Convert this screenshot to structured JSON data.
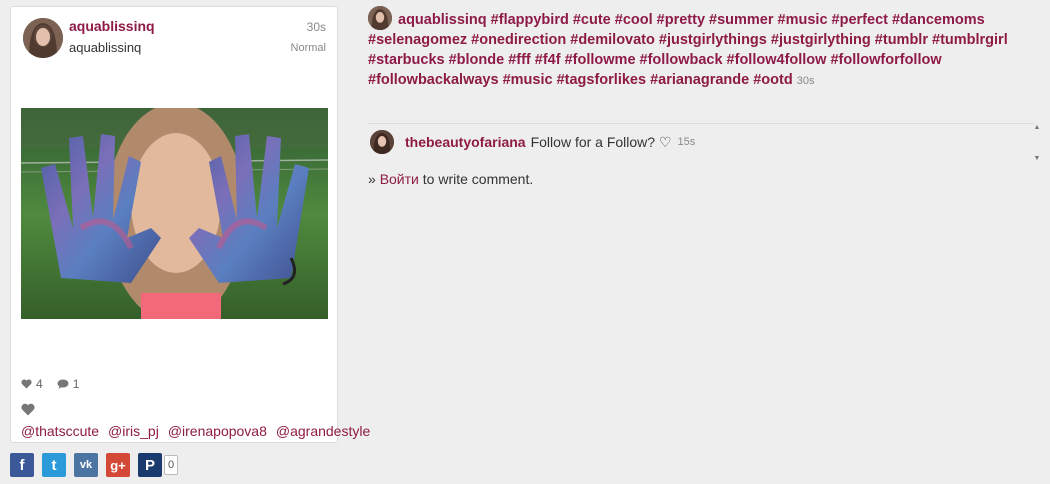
{
  "post": {
    "username": "aquablissinq",
    "fullname": "aquablissinq",
    "time": "30s",
    "filter": "Normal",
    "likes_count": "4",
    "comments_count": "1",
    "likers": [
      "@thatsccute",
      "@iris_pj",
      "@irenapopova8",
      "@agrandestyle"
    ],
    "caption_user": "aquablissinq",
    "caption_text": "#flappybird #cute #cool #pretty #summer #music #perfect #dancemoms #selenagomez #onedirection #demilovato #justgirlythings #justgirlything #tumblr #tumblrgirl #starbucks #blonde #fff #f4f #followme #followback #follow4follow #followforfollow #followbackalways #music #tagsforlikes #arianagrande #ootd",
    "caption_time": "30s"
  },
  "comments": [
    {
      "user": "thebeautyofariana",
      "text": "Follow for a Follow? ♡",
      "time": "15s"
    }
  ],
  "login": {
    "prefix": "»",
    "link": "Войти",
    "suffix": "to write comment."
  },
  "share": {
    "buttons": [
      {
        "name": "facebook",
        "glyph": "f",
        "color": "#3b5998"
      },
      {
        "name": "twitter",
        "glyph": "t",
        "color": "#2b9ad8"
      },
      {
        "name": "vk",
        "glyph": "vk",
        "color": "#4d75a3"
      },
      {
        "name": "googleplus",
        "glyph": "g+",
        "color": "#d34836"
      },
      {
        "name": "pinterest",
        "glyph": "P",
        "color": "#1b3b6e"
      }
    ],
    "count": "0"
  },
  "colors": {
    "accent": "#8e1b45",
    "background": "#eeeeee",
    "card": "#ffffff"
  }
}
